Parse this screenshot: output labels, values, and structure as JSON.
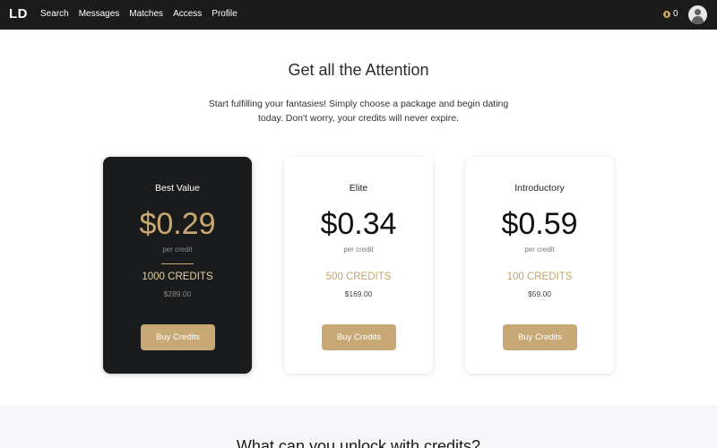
{
  "header": {
    "logo": "LD",
    "nav": [
      "Search",
      "Messages",
      "Matches",
      "Access",
      "Profile"
    ],
    "credits_count": "0"
  },
  "main": {
    "title": "Get all the Attention",
    "subtitle": "Start fulfilling your fantasies! Simply choose a package and begin dating today. Don't worry, your credits will never expire."
  },
  "packages": [
    {
      "name": "Best Value",
      "price": "$0.29",
      "per": "per credit",
      "credits": "1000 CREDITS",
      "total": "$289.00",
      "button": "Buy Credits",
      "highlighted": true
    },
    {
      "name": "Elite",
      "price": "$0.34",
      "per": "per credit",
      "credits": "500 CREDITS",
      "total": "$169.00",
      "button": "Buy Credits",
      "highlighted": false
    },
    {
      "name": "Introductory",
      "price": "$0.59",
      "per": "per credit",
      "credits": "100 CREDITS",
      "total": "$59.00",
      "button": "Buy Credits",
      "highlighted": false
    }
  ],
  "unlock": {
    "title": "What can you unlock with credits?"
  },
  "colors": {
    "topbar": "#1b1b1b",
    "accent_gold": "#c8a875",
    "dark_card": "#1a1b1d"
  }
}
